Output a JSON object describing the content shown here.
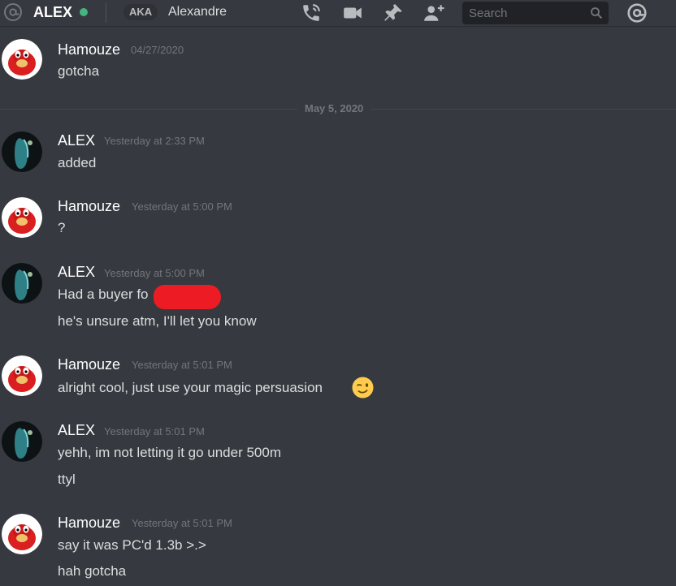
{
  "header": {
    "channel_name": "ALEX",
    "aka_label": "AKA",
    "aka_name": "Alexandre",
    "search_placeholder": "Search",
    "icons": [
      "at-icon",
      "status-online",
      "call-icon",
      "video-icon",
      "pin-icon",
      "add-friend-icon",
      "search-icon",
      "mentions-icon"
    ],
    "status_color": "#43b581"
  },
  "date_divider": "May 5, 2020",
  "messages": [
    {
      "author": "Hamouze",
      "timestamp": "04/27/2020",
      "lines": [
        "gotcha"
      ]
    },
    {
      "author": "ALEX",
      "timestamp": "Yesterday at 2:33 PM",
      "lines": [
        "added"
      ]
    },
    {
      "author": "Hamouze",
      "timestamp": "Yesterday at 5:00 PM",
      "lines": [
        "?"
      ]
    },
    {
      "author": "ALEX",
      "timestamp": "Yesterday at 5:00 PM",
      "lines": [
        "Had a buyer fo",
        "he's unsure atm, I'll let you know"
      ]
    },
    {
      "author": "Hamouze",
      "timestamp": "Yesterday at 5:01 PM",
      "lines": [
        "alright cool, just use your magic persuasion"
      ]
    },
    {
      "author": "ALEX",
      "timestamp": "Yesterday at 5:01 PM",
      "lines": [
        "yehh, im not letting it go under 500m",
        "ttyl"
      ]
    },
    {
      "author": "Hamouze",
      "timestamp": "Yesterday at 5:01 PM",
      "lines": [
        "say it was PC'd 1.3b >.>",
        "hah gotcha"
      ]
    }
  ],
  "colors": {
    "background": "#36393f",
    "author": "#ffffff",
    "timestamp": "#72767d",
    "text": "#dcddde",
    "redaction": "#ed1c24"
  }
}
